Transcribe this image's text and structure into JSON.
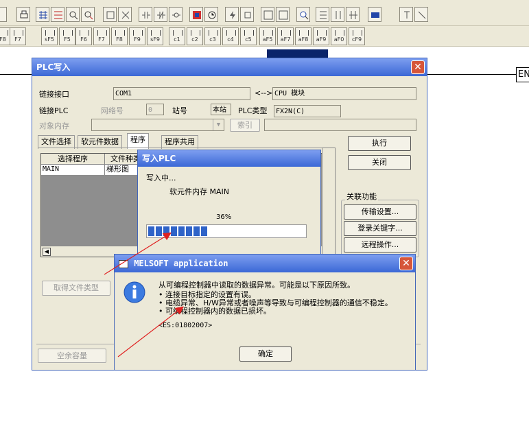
{
  "plc_write": {
    "title": "PLC写入",
    "connection_interface_label": "链接接口",
    "connection_interface_value": "COM1",
    "arrow_text": "<-->",
    "cpu_module_value": "CPU 模块",
    "connection_plc_label": "链接PLC",
    "network_no_label": "网络号",
    "network_no_value": "0",
    "station_label": "站号",
    "station_value": "本站",
    "plc_type_label": "PLC类型",
    "plc_type_value": "FX2N(C)",
    "target_memory_label": "对象内存",
    "index_button": "索引",
    "tabs": [
      "文件选择",
      "软元件数据",
      "程序",
      "程序共用"
    ],
    "table_headers": [
      "选择程序",
      "文件种类"
    ],
    "table_row": [
      "MAIN",
      "梯形图"
    ],
    "get_file_type_button": "取得文件类型",
    "free_capacity_button": "空余容量",
    "execute_button": "执行",
    "close_button": "关闭",
    "related_functions_label": "关联功能",
    "transfer_settings_button": "传输设置...",
    "register_keyword_button": "登录关键字...",
    "remote_operation_button": "远程操作..."
  },
  "progress": {
    "title": "写入PLC",
    "status_text": "写入中...",
    "detail_text": "软元件内存  MAIN",
    "percent_text": "36%",
    "percent_value": 0.36
  },
  "melsoft": {
    "title": "MELSOFT application",
    "message_line1": "从可编程控制器中读取的数据异常。可能是以下原因所致。",
    "message_line2": "• 连接目标指定的设置有误。",
    "message_line3": "• 电缆异常、H/W异常或者噪声等导致与可编程控制器的通信不稳定。",
    "message_line4": "• 可编程控制器内的数据已损坏。",
    "error_code": "<ES:01802007>",
    "ok_button": "确定"
  },
  "ladder": {
    "end_label": "EN"
  },
  "toolbar": {
    "fkeys": [
      "F8",
      "F7",
      "sF5",
      "F5",
      "F6",
      "F7",
      "F8",
      "F9",
      "sF9",
      "c1",
      "c2",
      "c3",
      "c4",
      "c5",
      "aF5",
      "aF7",
      "aF8",
      "aF9",
      "aF0",
      "cF9"
    ]
  },
  "colors": {
    "title_bar": "#3b68d6",
    "window_bg": "#ece9d8",
    "close_red": "#d6563a",
    "progress_blue": "#2f63c8",
    "arrow_red": "#e02020"
  }
}
